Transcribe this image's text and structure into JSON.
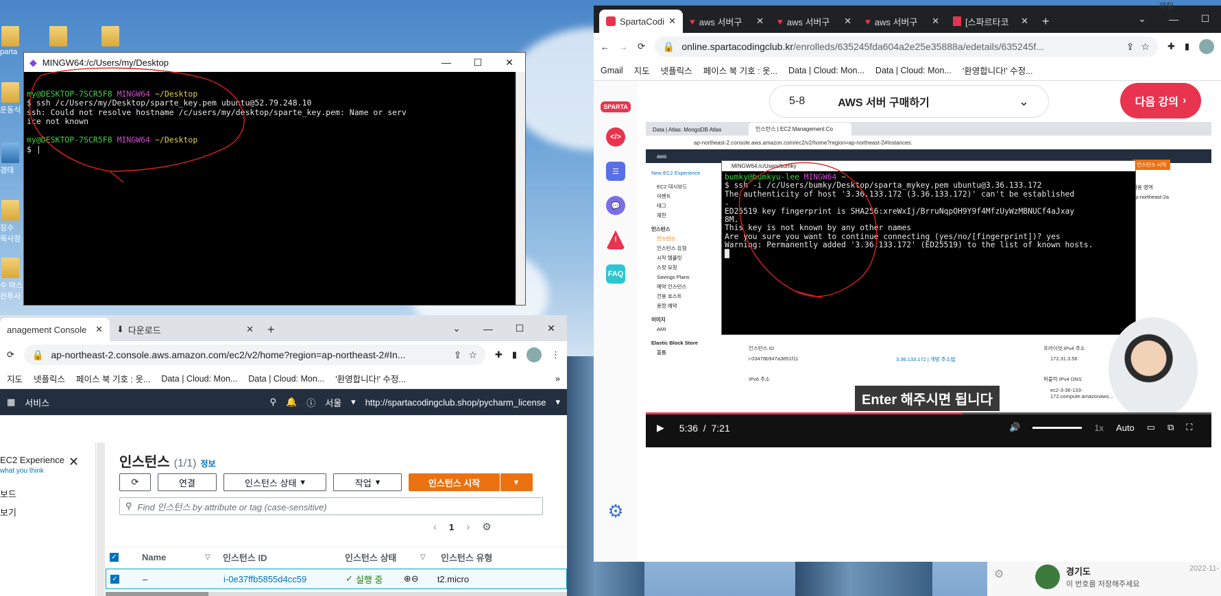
{
  "desktop": {
    "icons": [
      "parta",
      "운동식",
      "경태",
      "징수\n목사점",
      "수 마스\n전투사"
    ],
    "top_right_text": "재형"
  },
  "terminal_left": {
    "title": "MINGW64:/c/Users/my/Desktop",
    "lines": [
      {
        "user": "my@DESKTOP-7SCR5F8",
        "env": "MINGW64",
        "path": "~/Desktop"
      },
      {
        "text": "$ ssh /c/Users/my/Desktop/sparte_key.pem ubuntu@52.79.248.10"
      },
      {
        "text": "ssh: Could not resolve hostname /c/users/my/desktop/sparte_key.pem: Name or serv"
      },
      {
        "text": "ice not known"
      },
      {
        "text": ""
      },
      {
        "user": "my@DESKTOP-7SCR5F8",
        "env": "MINGW64",
        "path": "~/Desktop"
      },
      {
        "text": "$ |"
      }
    ]
  },
  "chrome_left": {
    "tabs": [
      {
        "label": "anagement Console"
      },
      {
        "label": "다운로드"
      }
    ],
    "new_tab": "+",
    "url": "ap-northeast-2.console.aws.amazon.com/ec2/v2/home?region=ap-northeast-2#In...",
    "bookmarks": [
      "지도",
      "넷플릭스",
      "페이스 북 기호 : 옷...",
      "Data | Cloud: Mon...",
      "Data | Cloud: Mon...",
      "'환영합니다!' 수정..."
    ],
    "aws": {
      "services": "서비스",
      "region": "서울",
      "license_link": "http://spartacodingclub.shop/pycharm_license",
      "side_panel": {
        "title": "EC2 Experience",
        "subtitle": "what you think",
        "items": [
          "보드",
          "보기"
        ]
      },
      "heading": "인스턴스",
      "count": "(1/1)",
      "info": "정보",
      "buttons": {
        "connect": "연결",
        "state": "인스턴스 상태",
        "actions": "작업",
        "launch": "인스턴스 시작"
      },
      "search_placeholder": "Find 인스턴스 by attribute or tag (case-sensitive)",
      "page": "1",
      "columns": [
        "Name",
        "인스턴스 ID",
        "인스턴스 상태",
        "인스턴스 유형"
      ],
      "rows": [
        {
          "name": "–",
          "id": "i-0e37ffb5855d4cc59",
          "state": "실행 중",
          "type": "t2.micro"
        }
      ]
    }
  },
  "chrome_right": {
    "tabs": [
      {
        "label": "SpartaCodin"
      },
      {
        "label": "aws 서버구"
      },
      {
        "label": "aws 서버구"
      },
      {
        "label": "aws 서버구"
      },
      {
        "label": "[스파르타코"
      }
    ],
    "url_host": "online.spartacodingclub.kr",
    "url_path": "/enrolleds/635245fda604a2e25e35888a/edetails/635245f...",
    "bookmarks": [
      "Gmail",
      "지도",
      "넷플릭스",
      "페이스 북 기호 : 옷...",
      "Data | Cloud: Mon...",
      "Data | Cloud: Mon...",
      "'환영합니다!' 수정..."
    ],
    "lesson": {
      "number": "5-8",
      "title": "AWS 서버 구매하기",
      "next": "다음 강의"
    },
    "sidebar": {
      "faq": "FAQ",
      "logo": "SPARTA"
    }
  },
  "video": {
    "inner_tabs": [
      "Data | Atlas: MongoDB Atlas",
      "인스턴스 | EC2 Management Co"
    ],
    "inner_url": "ap-northeast-2.console.aws.amazon.com/ec2/v2/home?region=ap-northeast-2#Instances:",
    "inner_terminal_title": "MINGW64:/c/Users/bumky",
    "inner_lines": [
      {
        "user": "bumky@bumkyu-lee",
        "env": "MINGW64",
        "path": "~"
      },
      {
        "text": "$ ssh -i /c/Users/bumky/Desktop/sparta_mykey.pem ubuntu@3.36.133.172"
      },
      {
        "text": "The authenticity of host '3.36.133.172 (3.36.133.172)' can't be established"
      },
      {
        "text": "."
      },
      {
        "text": "ED25519 key fingerprint is SHA256:xreWxIj/BrruNqpOH9Y9f4MfzUyWzMBNUCf4aJxay"
      },
      {
        "text": "8M."
      },
      {
        "text": "This key is not known by any other names"
      },
      {
        "text": "Are you sure you want to continue connecting (yes/no/[fingerprint])? yes"
      },
      {
        "text": "Warning: Permanently added '3.36.133.172' (ED25519) to the list of known hosts."
      }
    ],
    "inner_side": [
      "New EC2 Experience",
      "EC2 대시보드",
      "이벤트",
      "태그",
      "제한",
      "인스턴스",
      "인스턴스",
      "인스턴스 유형",
      "시작 템플릿",
      "스팟 요청",
      "Savings Plans",
      "예약 인스턴스",
      "전용 호스트",
      "용량 예약",
      "이미지",
      "AMI",
      "Elastic Block Store",
      "볼륨"
    ],
    "inner_details": {
      "id_label": "인스턴스 ID",
      "id": "i-03478b947a3851f11",
      "ip": "3.36.133.172 | 개방 주소법",
      "private_label": "프라이빗 IPv4 주소",
      "private": "172.31.3.56",
      "ipv6": "IPv6 주소",
      "dns_label": "퍼블릭 IPv4 DNS",
      "dns": "ec2-3-36-133-172.compute.amazonaws...",
      "region": "ap-northeast-2a",
      "az": "가용 영역",
      "launch": "인스턴스 시작"
    },
    "caption": "Enter 해주시면 됩니다",
    "time_current": "5:36",
    "time_total": "7:21",
    "speed": "1x",
    "quality": "Auto"
  },
  "bottom_right": {
    "name": "경기도",
    "date": "2022-11-",
    "snippet": "이 번호를 저장해주세요"
  }
}
